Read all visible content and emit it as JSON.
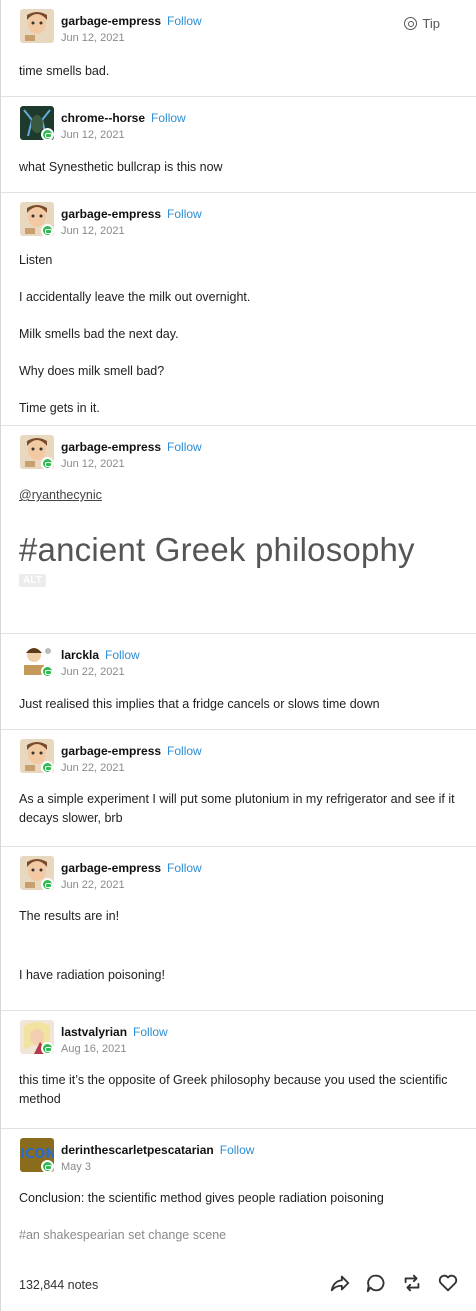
{
  "tip_label": "Tip",
  "follow_label": "Follow",
  "posts": [
    {
      "username": "garbage-empress",
      "date": "Jun 12, 2021",
      "lines": [
        "time smells bad."
      ]
    },
    {
      "username": "chrome--horse",
      "date": "Jun 12, 2021",
      "lines": [
        "what Synesthetic bullcrap is this now"
      ]
    },
    {
      "username": "garbage-empress",
      "date": "Jun 12, 2021",
      "lines": [
        "Listen",
        "I accidentally leave the milk out overnight.",
        "Milk smells bad the next day.",
        "Why does milk smell bad?",
        "Time gets in it."
      ]
    },
    {
      "username": "garbage-empress",
      "date": "Jun 12, 2021",
      "mention": "@ryanthecynic",
      "hero_text": "#ancient Greek philosophy",
      "alt_badge": "ALT"
    },
    {
      "username": "larckla",
      "date": "Jun 22, 2021",
      "lines": [
        "Just realised this implies that a fridge cancels or slows time down"
      ]
    },
    {
      "username": "garbage-empress",
      "date": "Jun 22, 2021",
      "lines": [
        "As a simple experiment I will put some plutonium in my refrigerator and see if it decays slower, brb"
      ]
    },
    {
      "username": "garbage-empress",
      "date": "Jun 22, 2021",
      "lines": [
        "The results are in!",
        "I have radiation poisoning!"
      ]
    },
    {
      "username": "lastvalyrian",
      "date": "Aug 16, 2021",
      "lines": [
        "this time it’s the opposite of Greek philosophy because you used the scientific method"
      ]
    },
    {
      "username": "derinthescarletpescatarian",
      "date": "May 3",
      "avatar_text": "ICON",
      "lines": [
        "Conclusion: the scientific method gives people radiation poisoning"
      ],
      "tag": "#an shakespearian set change scene"
    }
  ],
  "footer": {
    "notes": "132,844 notes"
  }
}
